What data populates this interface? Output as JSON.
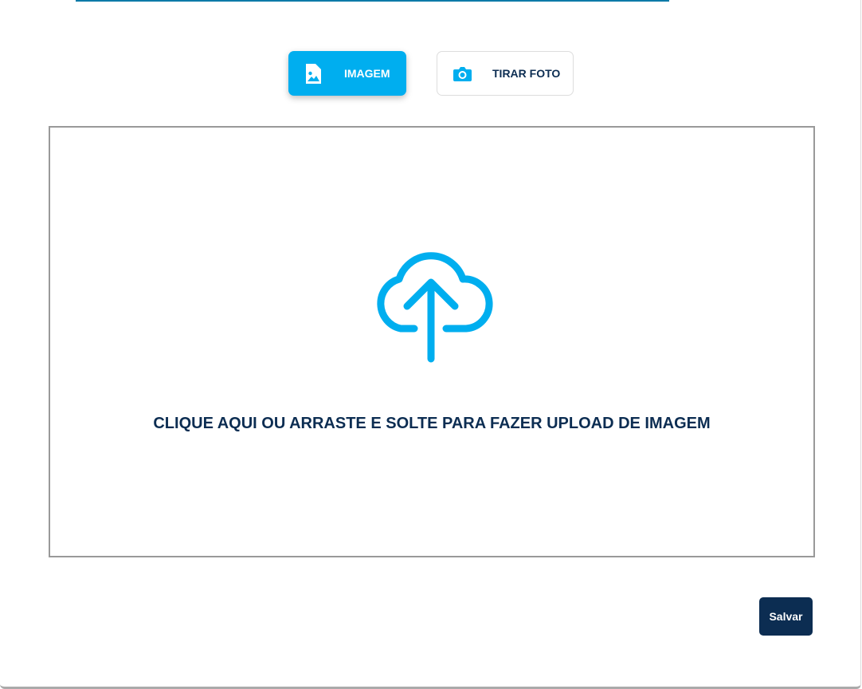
{
  "tabs": [
    {
      "label": "IMAGEM",
      "icon": "image-file-icon",
      "active": true
    },
    {
      "label": "TIRAR FOTO",
      "icon": "camera-icon",
      "active": false
    }
  ],
  "dropzone": {
    "icon": "cloud-upload-icon",
    "text": "CLIQUE AQUI OU ARRASTE E SOLTE PARA FAZER UPLOAD DE IMAGEM"
  },
  "save_label": "Salvar",
  "colors": {
    "accent": "#00aeef",
    "primary": "#0c2d52"
  }
}
